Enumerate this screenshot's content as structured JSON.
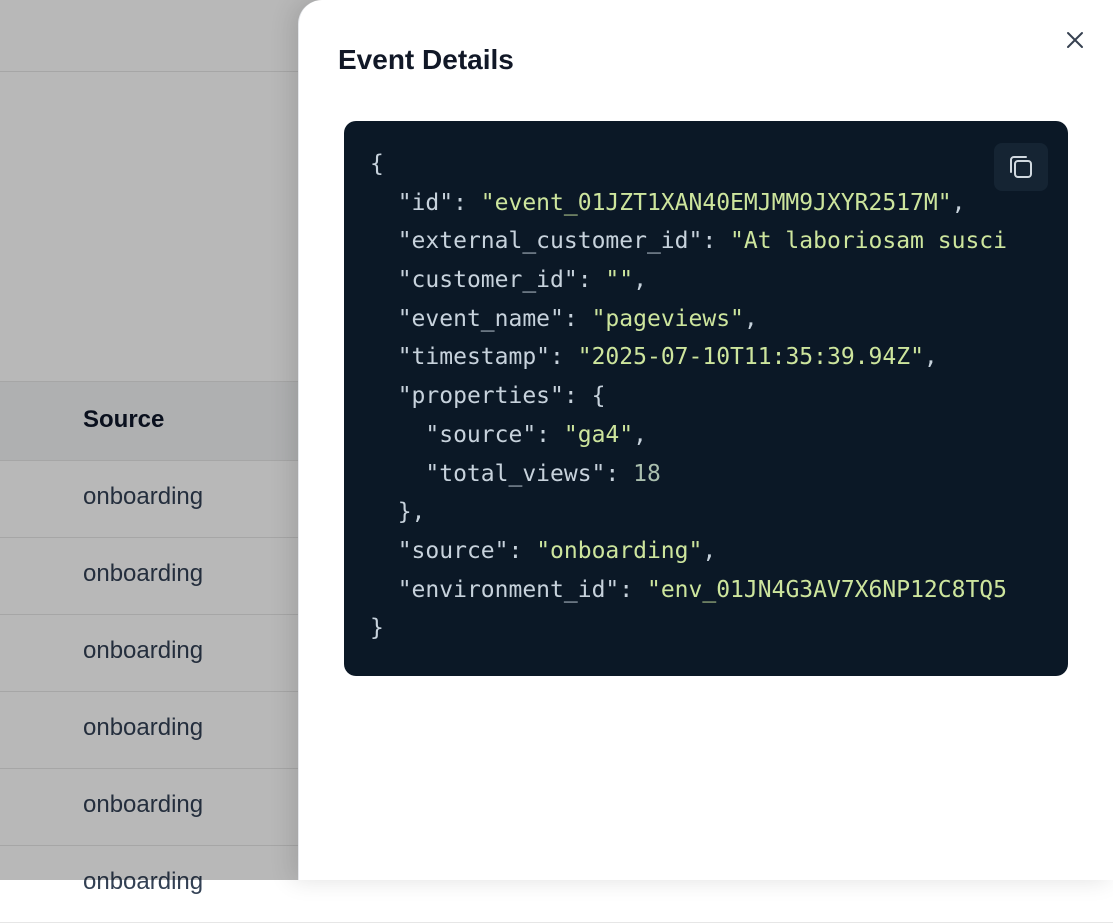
{
  "table": {
    "header_source": "Source",
    "rows": [
      "onboarding",
      "onboarding",
      "onboarding",
      "onboarding",
      "onboarding",
      "onboarding"
    ]
  },
  "modal": {
    "title": "Event Details",
    "close_icon": "close-icon",
    "copy_icon": "copy-icon"
  },
  "json_view": {
    "open_brace": "{",
    "close_brace": "}",
    "id_key": "\"id\"",
    "id_value": "\"event_01JZT1XAN40EMJMM9JXYR2517M\"",
    "external_customer_id_key": "\"external_customer_id\"",
    "external_customer_id_value": "\"At laboriosam susci",
    "customer_id_key": "\"customer_id\"",
    "customer_id_value": "\"\"",
    "event_name_key": "\"event_name\"",
    "event_name_value": "\"pageviews\"",
    "timestamp_key": "\"timestamp\"",
    "timestamp_value": "\"2025-07-10T11:35:39.94Z\"",
    "properties_key": "\"properties\"",
    "prop_source_key": "\"source\"",
    "prop_source_value": "\"ga4\"",
    "total_views_key": "\"total_views\"",
    "total_views_value": "18",
    "source_key": "\"source\"",
    "source_value": "\"onboarding\"",
    "environment_id_key": "\"environment_id\"",
    "environment_id_value": "\"env_01JN4G3AV7X6NP12C8TQ5"
  },
  "colors": {
    "code_bg": "#0b1826",
    "string": "#cde59d",
    "key": "#c7d2dc",
    "number": "#aabfae"
  }
}
